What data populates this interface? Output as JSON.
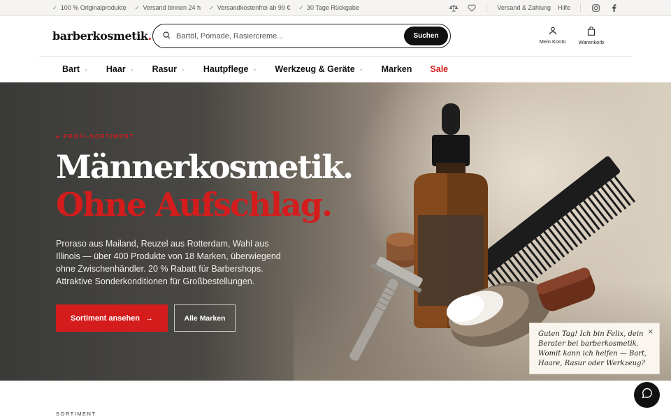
{
  "topbar": {
    "usps": [
      "100 % Originalprodukte",
      "Versand binnen 24 h",
      "Versandkostenfrei ab 99 €",
      "30 Tage Rückgabe"
    ],
    "links": [
      "Versand & Zahlung",
      "Hilfe"
    ],
    "icons": [
      "scale-icon",
      "heart-icon",
      "instagram-icon",
      "facebook-icon"
    ]
  },
  "header": {
    "logo": "barberkosmetik",
    "logo_dot": ".",
    "search_placeholder": "Bartöl, Pomade, Rasiercreme...",
    "search_button": "Suchen",
    "account_label": "Mein Konto",
    "cart_label": "Warenkorb"
  },
  "nav": {
    "items": [
      {
        "label": "Bart",
        "has_dropdown": true
      },
      {
        "label": "Haar",
        "has_dropdown": true
      },
      {
        "label": "Rasur",
        "has_dropdown": true
      },
      {
        "label": "Hautpflege",
        "has_dropdown": true
      },
      {
        "label": "Werkzeug & Geräte",
        "has_dropdown": true
      },
      {
        "label": "Marken",
        "has_dropdown": false
      },
      {
        "label": "Sale",
        "has_dropdown": false
      }
    ]
  },
  "hero": {
    "eyebrow": "● PROFI-SORTIMENT",
    "title_line1": "Männerkosmetik.",
    "title_line2": "Ohne Aufschlag.",
    "lead": "Proraso aus Mailand, Reuzel aus Rotterdam, Wahl aus Illinois — über 400 Produkte von 18 Marken, überwiegend ohne Zwischenhändler. 20 % Rabatt für Barbershops. Attraktive Sonderkonditionen für Großbestellungen.",
    "cta_primary": "Sortiment ansehen",
    "cta_secondary": "Alle Marken"
  },
  "chat": {
    "message": "Guten Tag! Ich bin Felix, dein Berater bei barberkosmetik. Womit kann ich helfen — Bart, Haare, Rasur oder Werkzeug?",
    "close": "×"
  },
  "section": {
    "label": "SORTIMENT"
  },
  "colors": {
    "accent": "#d51c1c",
    "dark": "#111111",
    "topbar_bg": "#f5f4f2"
  }
}
